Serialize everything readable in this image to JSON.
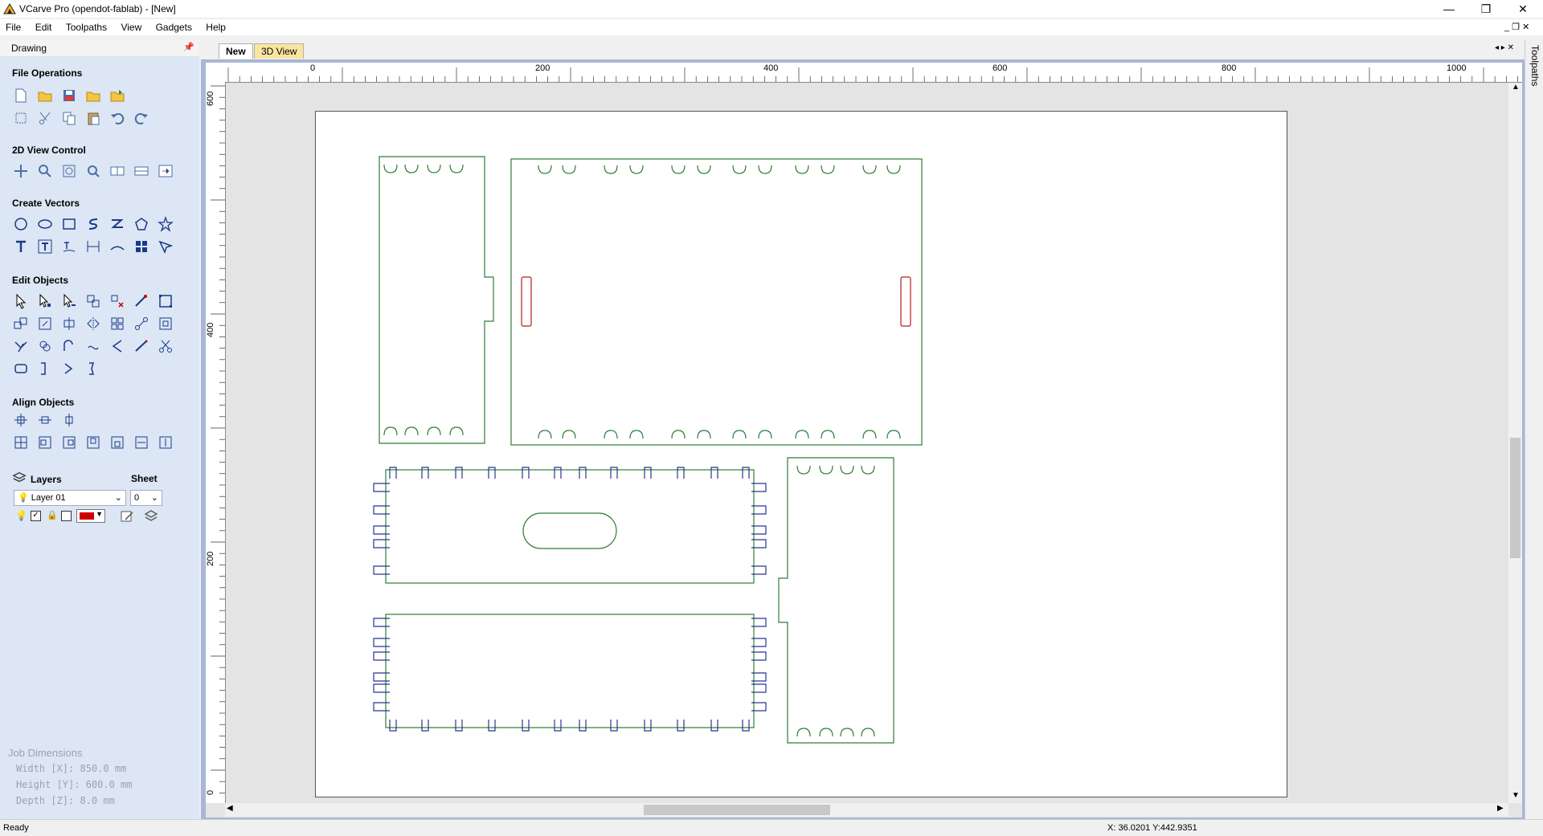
{
  "window": {
    "title": "VCarve Pro (opendot-fablab) - [New]",
    "controls": [
      "—",
      "❐",
      "✕"
    ]
  },
  "menu": [
    "File",
    "Edit",
    "Toolpaths",
    "View",
    "Gadgets",
    "Help"
  ],
  "panel": {
    "header": "Drawing",
    "pin_icon": "pin-icon",
    "sections": {
      "file_operations": "File Operations",
      "view_control": "2D View Control",
      "create_vectors": "Create Vectors",
      "edit_objects": "Edit Objects",
      "align_objects": "Align Objects"
    },
    "layers": {
      "title": "Layers",
      "sheet_label": "Sheet",
      "layer_value": "Layer 01",
      "sheet_value": "0"
    },
    "job_dimensions": {
      "title": "Job Dimensions",
      "width": "Width  [X]: 850.0 mm",
      "height": "Height [Y]: 600.0 mm",
      "depth": "Depth  [Z]: 8.0 mm"
    }
  },
  "tabs": [
    "New",
    "3D View"
  ],
  "ruler": {
    "h_labels": [
      "0",
      "200",
      "400",
      "600",
      "800",
      "1000"
    ],
    "v_labels": [
      "600",
      "400",
      "200",
      "0"
    ]
  },
  "right_strip_label": "Toolpaths",
  "status": {
    "left": "Ready",
    "coords": "X: 36.0201 Y:442.9351"
  },
  "colors": {
    "vector_green": "#2e7d32",
    "vector_blue": "#283593",
    "vector_red": "#b71c1c",
    "panel_bg": "#dce6f4"
  }
}
